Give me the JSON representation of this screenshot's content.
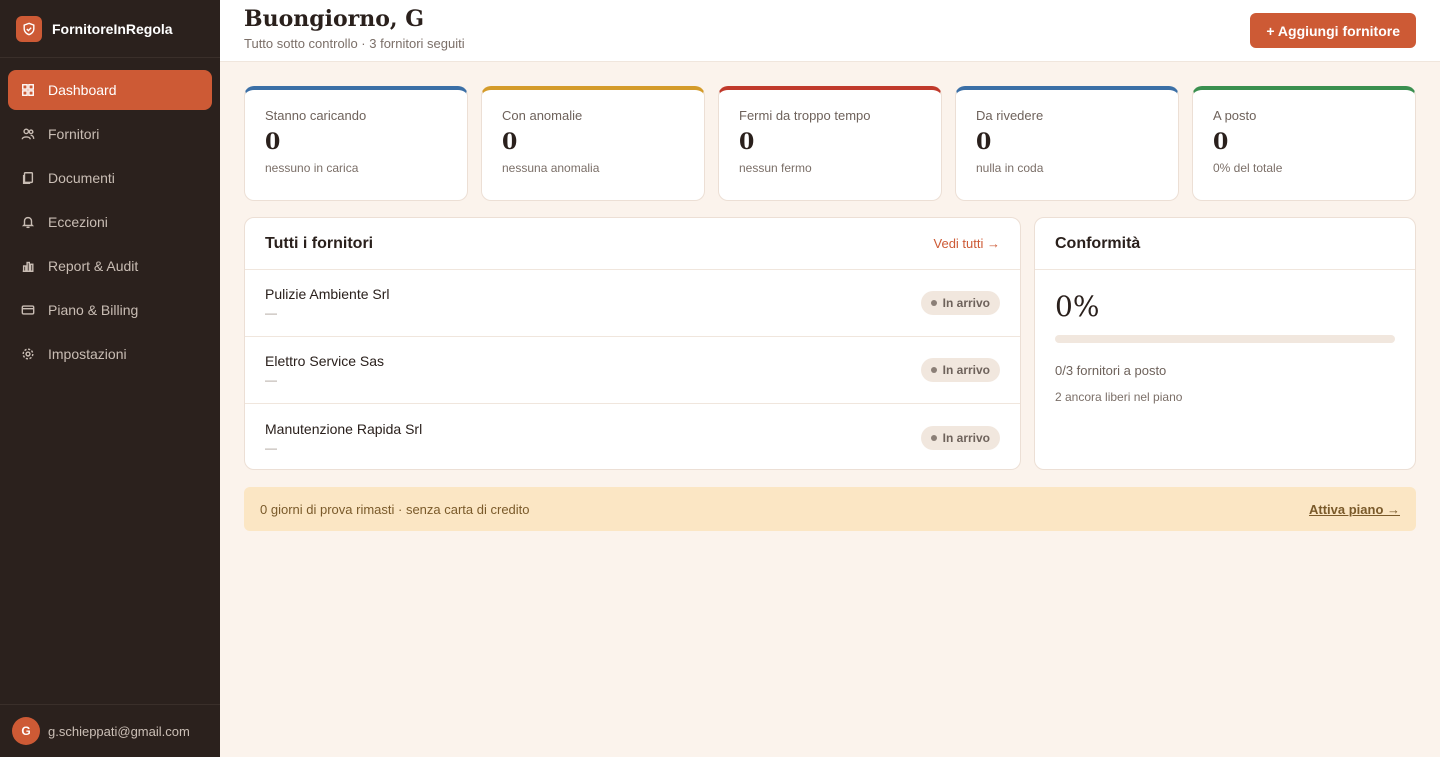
{
  "brand": {
    "name": "FornitoreInRegola",
    "logo_icon": "shield-icon"
  },
  "nav": [
    {
      "label": "Dashboard",
      "icon": "grid-icon",
      "active": true
    },
    {
      "label": "Fornitori",
      "icon": "users-icon",
      "active": false
    },
    {
      "label": "Documenti",
      "icon": "document-icon",
      "active": false
    },
    {
      "label": "Eccezioni",
      "icon": "bell-icon",
      "active": false
    },
    {
      "label": "Report & Audit",
      "icon": "bar-chart-icon",
      "active": false
    },
    {
      "label": "Piano & Billing",
      "icon": "card-icon",
      "active": false
    },
    {
      "label": "Impostazioni",
      "icon": "gear-icon",
      "active": false
    }
  ],
  "user": {
    "initial": "G",
    "email": "g.schieppati@gmail.com"
  },
  "header": {
    "greeting": "Buongiorno, G",
    "subtitle": "Tutto sotto controllo · 3 fornitori seguiti",
    "add_button": "+ Aggiungi fornitore"
  },
  "stats": [
    {
      "label": "Stanno caricando",
      "value": "0",
      "note": "nessuno in carica",
      "color": "#3b6fa6"
    },
    {
      "label": "Con anomalie",
      "value": "0",
      "note": "nessuna anomalia",
      "color": "#d49b2a"
    },
    {
      "label": "Fermi da troppo tempo",
      "value": "0",
      "note": "nessun fermo",
      "color": "#c0392b"
    },
    {
      "label": "Da rivedere",
      "value": "0",
      "note": "nulla in coda",
      "color": "#3b6fa6"
    },
    {
      "label": "A posto",
      "value": "0",
      "note": "0% del totale",
      "color": "#3a8f4f"
    }
  ],
  "suppliers": {
    "title": "Tutti i fornitori",
    "see_all": "Vedi tutti →",
    "rows": [
      {
        "name": "Pulizie Ambiente Srl",
        "sub": "—",
        "status": "In arrivo"
      },
      {
        "name": "Elettro Service Sas",
        "sub": "—",
        "status": "In arrivo"
      },
      {
        "name": "Manutenzione Rapida Srl",
        "sub": "—",
        "status": "In arrivo"
      }
    ]
  },
  "compliance": {
    "title": "Conformità",
    "percent": "0%",
    "progress": 0,
    "line1": "0/3 fornitori a posto",
    "line2": "2 ancora liberi nel piano"
  },
  "trial": {
    "text": "0 giorni di prova rimasti · senza carta di credito",
    "link": "Attiva piano →"
  },
  "colors": {
    "accent": "#cd5a35",
    "sidebar": "#2b211d",
    "background": "#fbf3ec"
  }
}
